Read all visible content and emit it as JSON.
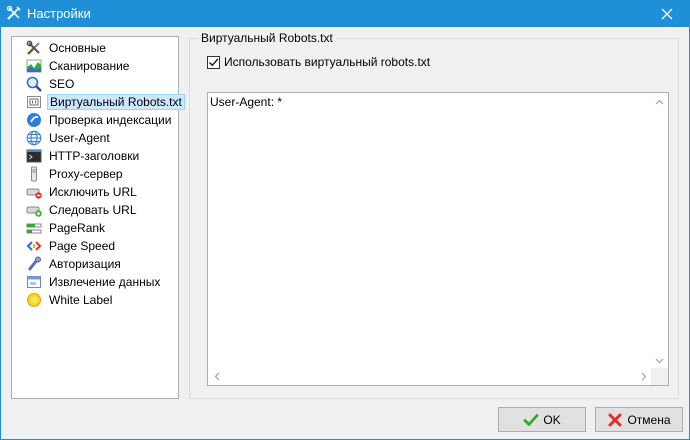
{
  "window": {
    "title": "Настройки",
    "close_icon": "close-icon",
    "app_icon": "tools-icon"
  },
  "sidebar": {
    "items": [
      {
        "label": "Основные",
        "icon": "tools-icon"
      },
      {
        "label": "Сканирование",
        "icon": "chart-icon"
      },
      {
        "label": "SEO",
        "icon": "magnifier-icon"
      },
      {
        "label": "Виртуальный Robots.txt",
        "icon": "robots-file-icon",
        "selected": true
      },
      {
        "label": "Проверка индексации",
        "icon": "blue-globe-icon"
      },
      {
        "label": "User-Agent",
        "icon": "globe-icon"
      },
      {
        "label": "HTTP-заголовки",
        "icon": "terminal-icon"
      },
      {
        "label": "Proxy-сервер",
        "icon": "proxy-icon"
      },
      {
        "label": "Исключить URL",
        "icon": "exclude-icon"
      },
      {
        "label": "Следовать URL",
        "icon": "follow-icon"
      },
      {
        "label": "PageRank",
        "icon": "pagerank-icon"
      },
      {
        "label": "Page Speed",
        "icon": "pagespeed-icon"
      },
      {
        "label": "Авторизация",
        "icon": "key-icon"
      },
      {
        "label": "Извлечение данных",
        "icon": "extract-icon"
      },
      {
        "label": "White Label",
        "icon": "sun-icon"
      }
    ]
  },
  "panel": {
    "group_title": "Виртуальный Robots.txt",
    "checkbox_label": "Использовать виртуальный robots.txt",
    "checkbox_checked": true,
    "textarea_value": "User-Agent: *"
  },
  "buttons": {
    "ok_label": "OK",
    "cancel_label": "Отмена"
  },
  "colors": {
    "titlebar": "#1f8fd8",
    "selection_bg": "#cce8ff",
    "selection_border": "#99d1ff",
    "ok_icon": "#2eaa2e",
    "cancel_icon": "#e52e2e"
  }
}
